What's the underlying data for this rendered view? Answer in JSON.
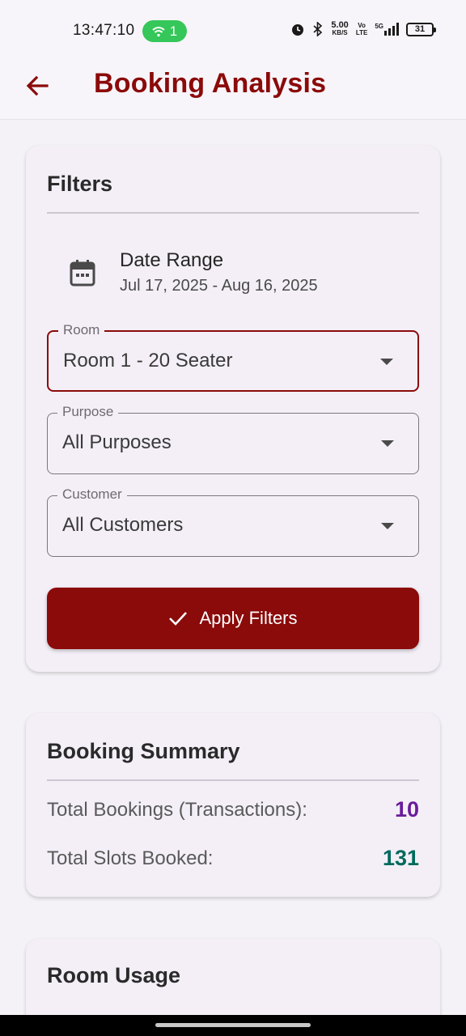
{
  "status_bar": {
    "time": "13:47:10",
    "hotspot_count": "1",
    "net_speed": "5.00",
    "net_unit": "KB/S",
    "volte_top": "Vo",
    "volte_bottom": "LTE",
    "signal_label": "5G",
    "battery": "31"
  },
  "app_bar": {
    "title": "Booking Analysis",
    "back_icon": "arrow-left-icon"
  },
  "filters": {
    "title": "Filters",
    "date_range_label": "Date Range",
    "date_range_value": "Jul 17, 2025 - Aug 16, 2025",
    "date_icon": "calendar-icon",
    "room": {
      "label": "Room",
      "value": "Room 1 - 20 Seater"
    },
    "purpose": {
      "label": "Purpose",
      "value": "All Purposes"
    },
    "customer": {
      "label": "Customer",
      "value": "All Customers"
    },
    "apply_label": "Apply Filters",
    "apply_icon": "check-icon"
  },
  "summary": {
    "title": "Booking Summary",
    "total_bookings_label": "Total Bookings (Transactions):",
    "total_bookings_value": "10",
    "total_slots_label": "Total Slots Booked:",
    "total_slots_value": "131"
  },
  "room_usage": {
    "title": "Room Usage"
  },
  "colors": {
    "accent": "#8b0a0a",
    "bookings_value": "#6a1b9a",
    "slots_value": "#00695c"
  }
}
